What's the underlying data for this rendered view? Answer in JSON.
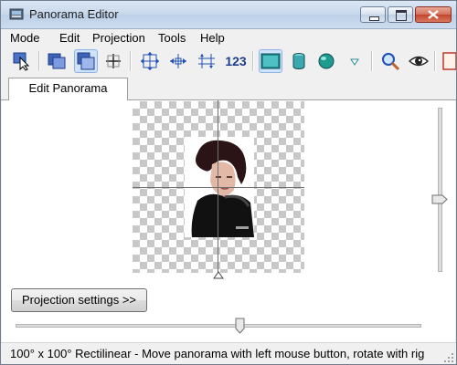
{
  "window": {
    "title": "Panorama Editor"
  },
  "menu": [
    "Mode",
    "Edit",
    "Projection",
    "Tools",
    "Help"
  ],
  "toolbar": {
    "numbers_label": "123",
    "buttons": [
      "select-tool-icon",
      "images-tool-icon",
      "crop-tool-icon",
      "control-points-icon",
      "center-icon",
      "fit-horizontal-icon",
      "fit-vertical-icon",
      "numbers-label",
      "rectilinear-icon",
      "cylinder-icon",
      "sphere-icon",
      "dropdown-icon",
      "zoom-icon",
      "preview-eye-icon"
    ]
  },
  "tabs": [
    {
      "label": "Edit Panorama",
      "active": true
    }
  ],
  "panel": {
    "projection_button": "Projection settings >>",
    "vertical_slider": {
      "level": 0.53
    },
    "horizontal_slider": {
      "level": 0.56
    }
  },
  "statusbar": {
    "text": "100° x 100° Rectilinear - Move panorama with left mouse button, rotate with rig"
  },
  "colors": {
    "accent": "#cfe3fb",
    "checker": "#c8c8c8",
    "titlebar": "#c7d8eb",
    "close": "#c2432b"
  }
}
